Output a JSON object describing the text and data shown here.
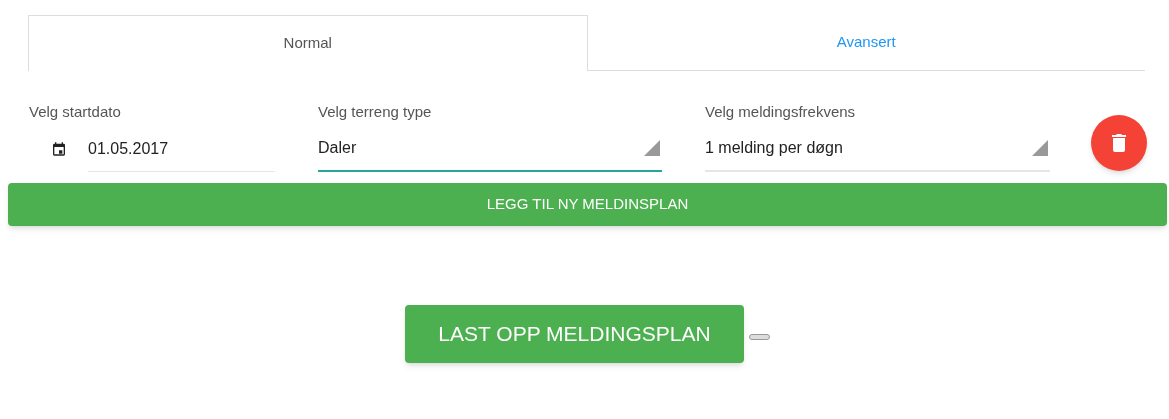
{
  "tabs": [
    {
      "label": "Normal",
      "selected": true
    },
    {
      "label": "Avansert",
      "selected": false
    }
  ],
  "date_field": {
    "label": "Velg startdato",
    "value": "01.05.2017"
  },
  "selects": [
    {
      "label": "Velg terreng type",
      "value": "Daler",
      "focused": true
    },
    {
      "label": "Velg meldingsfrekvens",
      "value": "1 melding per døgn",
      "focused": false
    }
  ],
  "add_button": "LEGG TIL NY MELDINSPLAN",
  "upload_button": "LAST OPP MELDINGSPLAN"
}
